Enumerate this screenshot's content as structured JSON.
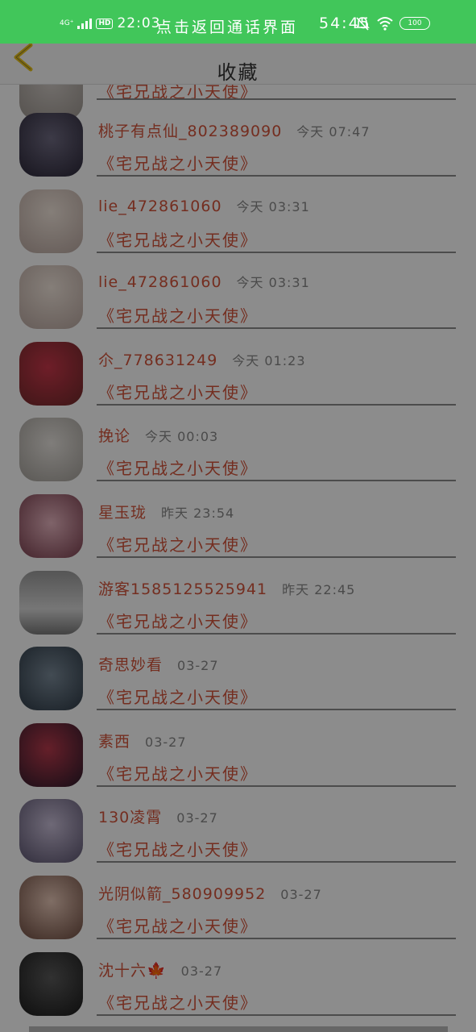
{
  "status_bar": {
    "network": "4G⁺",
    "hd": "HD",
    "time": "22:03",
    "call_banner": "点击返回通话界面",
    "call_timer": "54:45",
    "battery": "100"
  },
  "header": {
    "title": "收藏"
  },
  "list": {
    "partial_subtitle": "《宅兄战之小天使》",
    "items": [
      {
        "name": "桃子有点仙_802389090",
        "time": "今天 07:47",
        "subtitle": "《宅兄战之小天使》"
      },
      {
        "name": "lie_472861060",
        "time": "今天 03:31",
        "subtitle": "《宅兄战之小天使》"
      },
      {
        "name": "lie_472861060",
        "time": "今天 03:31",
        "subtitle": "《宅兄战之小天使》"
      },
      {
        "name": "尒_778631249",
        "time": "今天 01:23",
        "subtitle": "《宅兄战之小天使》"
      },
      {
        "name": "挽论",
        "time": "今天 00:03",
        "subtitle": "《宅兄战之小天使》"
      },
      {
        "name": "星玉珑",
        "time": "昨天 23:54",
        "subtitle": "《宅兄战之小天使》"
      },
      {
        "name": "游客1585125525941",
        "time": "昨天 22:45",
        "subtitle": "《宅兄战之小天使》"
      },
      {
        "name": "奇思妙看",
        "time": "03-27",
        "subtitle": "《宅兄战之小天使》"
      },
      {
        "name": "素西",
        "time": "03-27",
        "subtitle": "《宅兄战之小天使》"
      },
      {
        "name": "130凌霄",
        "time": "03-27",
        "subtitle": "《宅兄战之小天使》"
      },
      {
        "name": "光阴似箭_580909952",
        "time": "03-27",
        "subtitle": "《宅兄战之小天使》"
      },
      {
        "name": "沈十六🍁",
        "time": "03-27",
        "subtitle": "《宅兄战之小天使》"
      }
    ]
  },
  "colors": {
    "status_green": "#41c65a",
    "accent_red": "#d4543b",
    "back_arrow": "#e8c21a"
  }
}
